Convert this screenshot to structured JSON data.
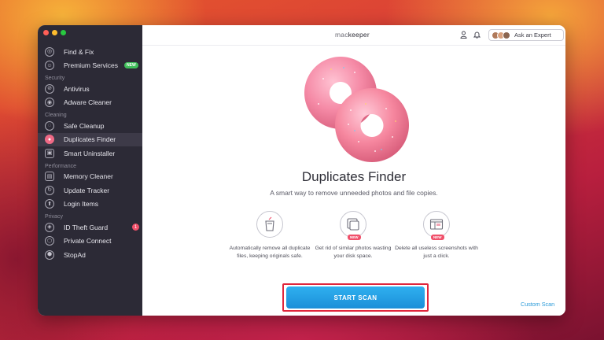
{
  "sidebar": {
    "items": [
      {
        "label": "Find & Fix",
        "icon": "find-fix-icon"
      },
      {
        "label": "Premium Services",
        "icon": "premium-services-icon",
        "badge": "NEW"
      },
      {
        "section": "Security"
      },
      {
        "label": "Antivirus",
        "icon": "antivirus-icon"
      },
      {
        "label": "Adware Cleaner",
        "icon": "adware-cleaner-icon"
      },
      {
        "section": "Cleaning"
      },
      {
        "label": "Safe Cleanup",
        "icon": "safe-cleanup-icon"
      },
      {
        "label": "Duplicates Finder",
        "icon": "duplicates-finder-icon",
        "active": true
      },
      {
        "label": "Smart Uninstaller",
        "icon": "smart-uninstaller-icon"
      },
      {
        "section": "Performance"
      },
      {
        "label": "Memory Cleaner",
        "icon": "memory-cleaner-icon"
      },
      {
        "label": "Update Tracker",
        "icon": "update-tracker-icon"
      },
      {
        "label": "Login Items",
        "icon": "login-items-icon"
      },
      {
        "section": "Privacy"
      },
      {
        "label": "ID Theft Guard",
        "icon": "id-theft-guard-icon",
        "count": "1"
      },
      {
        "label": "Private Connect",
        "icon": "private-connect-icon"
      },
      {
        "label": "StopAd",
        "icon": "stopad-icon"
      }
    ]
  },
  "header": {
    "brand_prefix": "mac",
    "brand_suffix": "keeper",
    "ask_expert_label": "Ask an Expert"
  },
  "main": {
    "title": "Duplicates Finder",
    "subtitle": "A smart way to remove unneeded photos and file copies.",
    "features": [
      {
        "text": "Automatically remove all duplicate files, keeping originals safe.",
        "icon": "trash-icon",
        "new": false
      },
      {
        "text": "Get rid of similar photos wasting your disk space.",
        "icon": "photos-icon",
        "new": true,
        "new_label": "NEW"
      },
      {
        "text": "Delete all useless screenshots with just a click.",
        "icon": "screenshots-icon",
        "new": true,
        "new_label": "NEW"
      }
    ],
    "scan_button": "START SCAN",
    "custom_scan": "Custom Scan"
  },
  "colors": {
    "accent": "#1b8fd8",
    "highlight": "#e0263c",
    "new_badge": "#3fbf5a",
    "alert_badge": "#f0506a",
    "sidebar_bg": "#2c2a36"
  }
}
